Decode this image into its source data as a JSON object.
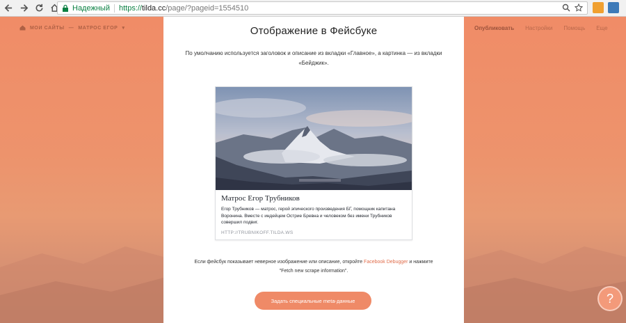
{
  "browser": {
    "secure_label": "Надежный",
    "url_scheme": "https://",
    "url_host": "tilda.cc",
    "url_path": "/page/?pageid=1554510"
  },
  "topbar": {
    "breadcrumb_sites": "МОИ САЙТЫ",
    "breadcrumb_sep": "—",
    "breadcrumb_project": "МАТРОС ЕГОР",
    "publish": "Опубликовать",
    "settings": "Настройки",
    "help": "Помощь",
    "more": "Еще"
  },
  "panel": {
    "title": "Отображение в Фейсбуке",
    "description": "По умолчанию используется заголовок и описание из вкладки «Главное», а картинка — из вкладки «Бейджик».",
    "card": {
      "title": "Матрос Егор Трубников",
      "text": "Егор Трубников — матрос, герой эпического произведения БГ, помощник капитана Воронина. Вместе с индейцем Острие Бревна и человеком без имени Трубников совершил подвиг.",
      "link": "HTTP://TRUBNIKOFF.TILDA.WS"
    },
    "note_before": "Если фейсбук показывает неверное изображение или описание, откройте ",
    "note_link": "Facebook Debugger",
    "note_after": " и нажмите \"Fetch new scrape information\".",
    "button": "Задать специальные meta-данные"
  },
  "help_button": "?",
  "colors": {
    "accent": "#ef8a67",
    "link": "#e06c4a",
    "secure_green": "#0b8043"
  }
}
